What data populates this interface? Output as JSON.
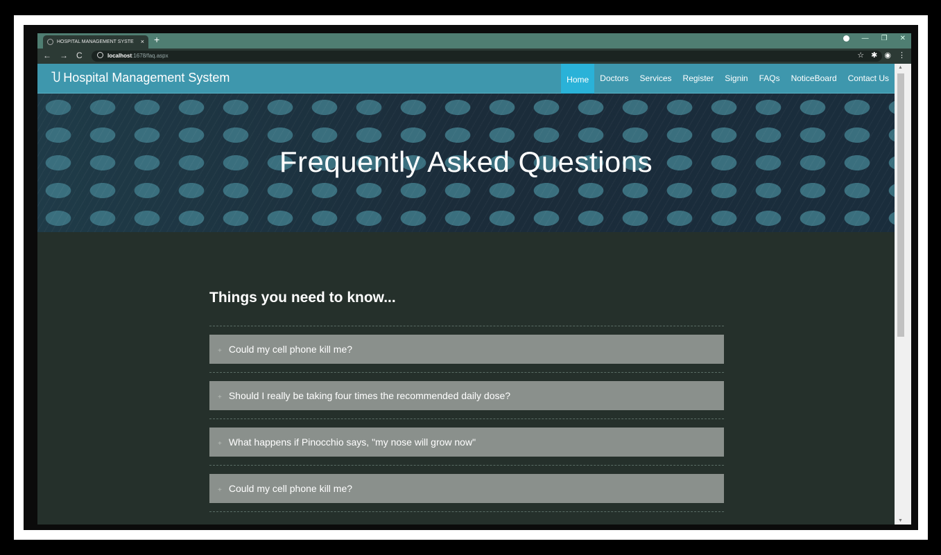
{
  "browser": {
    "tab_title": "HOSPITAL MANAGEMENT SYSTE",
    "new_tab": "+",
    "tab_close": "×",
    "url_host": "localhost",
    "url_path": ":1678/faq.aspx",
    "back": "←",
    "forward": "→",
    "reload": "C"
  },
  "navbar": {
    "brand": "Hospital Management System",
    "items": [
      {
        "label": "Home",
        "active": true
      },
      {
        "label": "Doctors"
      },
      {
        "label": "Services"
      },
      {
        "label": "Register"
      },
      {
        "label": "Signin"
      },
      {
        "label": "FAQs"
      },
      {
        "label": "NoticeBoard"
      },
      {
        "label": "Contact Us"
      }
    ]
  },
  "hero": {
    "title": "Frequently Asked Questions"
  },
  "faq": {
    "heading": "Things you need to know...",
    "items": [
      {
        "question": "Could my cell phone kill me?"
      },
      {
        "question": "Should I really be taking four times the recommended daily dose?"
      },
      {
        "question": "What happens if Pinocchio says, \"my nose will grow now\""
      },
      {
        "question": "Could my cell phone kill me?"
      }
    ]
  },
  "colors": {
    "navbar": "#3e97ad",
    "active_nav": "#2ab2d8",
    "page_bg": "#25302b",
    "faq_item_bg": "#8a908c"
  }
}
